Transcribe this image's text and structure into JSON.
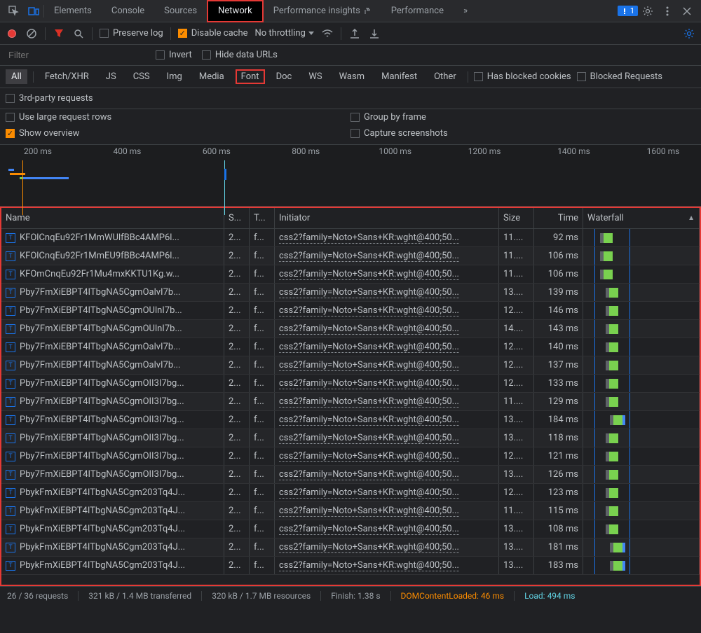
{
  "tabs": {
    "elements": "Elements",
    "console": "Console",
    "sources": "Sources",
    "network": "Network",
    "perf_insights": "Performance insights",
    "performance": "Performance",
    "more": "»",
    "issues_count": "1"
  },
  "toolbar": {
    "preserve_log": "Preserve log",
    "disable_cache": "Disable cache",
    "no_throttling": "No throttling"
  },
  "filter": {
    "placeholder": "Filter",
    "invert": "Invert",
    "hide_data": "Hide data URLs"
  },
  "types": {
    "all": "All",
    "fetch": "Fetch/XHR",
    "js": "JS",
    "css": "CSS",
    "img": "Img",
    "media": "Media",
    "font": "Font",
    "doc": "Doc",
    "ws": "WS",
    "wasm": "Wasm",
    "manifest": "Manifest",
    "other": "Other",
    "blocked_cookies": "Has blocked cookies",
    "blocked_req": "Blocked Requests"
  },
  "opts": {
    "third_party": "3rd-party requests",
    "large_rows": "Use large request rows",
    "group_frame": "Group by frame",
    "show_overview": "Show overview",
    "capture_ss": "Capture screenshots"
  },
  "timeline": {
    "ticks": [
      "200 ms",
      "400 ms",
      "600 ms",
      "800 ms",
      "1000 ms",
      "1200 ms",
      "1400 ms",
      "1600 ms"
    ]
  },
  "table": {
    "headers": {
      "name": "Name",
      "status": "S...",
      "type": "T...",
      "initiator": "Initiator",
      "size": "Size",
      "time": "Time",
      "waterfall": "Waterfall"
    },
    "rows": [
      {
        "name": "KFOlCnqEu92Fr1MmWUlfBBc4AMP6l...",
        "status": "2...",
        "type": "f...",
        "initiator": "css2?family=Noto+Sans+KR:wght@400;50...",
        "size": "11....",
        "time": "92 ms",
        "wf": 18
      },
      {
        "name": "KFOlCnqEu92Fr1MmEU9fBBc4AMP6l...",
        "status": "2...",
        "type": "f...",
        "initiator": "css2?family=Noto+Sans+KR:wght@400;50...",
        "size": "11....",
        "time": "106 ms",
        "wf": 18
      },
      {
        "name": "KFOmCnqEu92Fr1Mu4mxKKTU1Kg.w...",
        "status": "2...",
        "type": "f...",
        "initiator": "css2?family=Noto+Sans+KR:wght@400;50...",
        "size": "11....",
        "time": "106 ms",
        "wf": 18
      },
      {
        "name": "Pby7FmXiEBPT4ITbgNA5CgmOalvI7b...",
        "status": "2...",
        "type": "f...",
        "initiator": "css2?family=Noto+Sans+KR:wght@400;50...",
        "size": "13....",
        "time": "139 ms",
        "wf": 26
      },
      {
        "name": "Pby7FmXiEBPT4ITbgNA5CgmOUlnI7b...",
        "status": "2...",
        "type": "f...",
        "initiator": "css2?family=Noto+Sans+KR:wght@400;50...",
        "size": "12....",
        "time": "146 ms",
        "wf": 26
      },
      {
        "name": "Pby7FmXiEBPT4ITbgNA5CgmOUlnI7b...",
        "status": "2...",
        "type": "f...",
        "initiator": "css2?family=Noto+Sans+KR:wght@400;50...",
        "size": "14....",
        "time": "143 ms",
        "wf": 26
      },
      {
        "name": "Pby7FmXiEBPT4ITbgNA5CgmOalvI7b...",
        "status": "2...",
        "type": "f...",
        "initiator": "css2?family=Noto+Sans+KR:wght@400;50...",
        "size": "12....",
        "time": "140 ms",
        "wf": 26
      },
      {
        "name": "Pby7FmXiEBPT4ITbgNA5CgmOalvI7b...",
        "status": "2...",
        "type": "f...",
        "initiator": "css2?family=Noto+Sans+KR:wght@400;50...",
        "size": "12....",
        "time": "137 ms",
        "wf": 26
      },
      {
        "name": "Pby7FmXiEBPT4ITbgNA5CgmOII3I7bg...",
        "status": "2...",
        "type": "f...",
        "initiator": "css2?family=Noto+Sans+KR:wght@400;50...",
        "size": "12....",
        "time": "133 ms",
        "wf": 26
      },
      {
        "name": "Pby7FmXiEBPT4ITbgNA5CgmOII3I7bg...",
        "status": "2...",
        "type": "f...",
        "initiator": "css2?family=Noto+Sans+KR:wght@400;50...",
        "size": "11....",
        "time": "129 ms",
        "wf": 26
      },
      {
        "name": "Pby7FmXiEBPT4ITbgNA5CgmOII3I7bg...",
        "status": "2...",
        "type": "f...",
        "initiator": "css2?family=Noto+Sans+KR:wght@400;50...",
        "size": "13....",
        "time": "184 ms",
        "wf": 32
      },
      {
        "name": "Pby7FmXiEBPT4ITbgNA5CgmOII3I7bg...",
        "status": "2...",
        "type": "f...",
        "initiator": "css2?family=Noto+Sans+KR:wght@400;50...",
        "size": "13....",
        "time": "118 ms",
        "wf": 26
      },
      {
        "name": "Pby7FmXiEBPT4ITbgNA5CgmOII3I7bg...",
        "status": "2...",
        "type": "f...",
        "initiator": "css2?family=Noto+Sans+KR:wght@400;50...",
        "size": "12....",
        "time": "121 ms",
        "wf": 26
      },
      {
        "name": "Pby7FmXiEBPT4ITbgNA5CgmOII3I7bg...",
        "status": "2...",
        "type": "f...",
        "initiator": "css2?family=Noto+Sans+KR:wght@400;50...",
        "size": "13....",
        "time": "126 ms",
        "wf": 26
      },
      {
        "name": "PbykFmXiEBPT4ITbgNA5Cgm203Tq4J...",
        "status": "2...",
        "type": "f...",
        "initiator": "css2?family=Noto+Sans+KR:wght@400;50...",
        "size": "12....",
        "time": "123 ms",
        "wf": 26
      },
      {
        "name": "PbykFmXiEBPT4ITbgNA5Cgm203Tq4J...",
        "status": "2...",
        "type": "f...",
        "initiator": "css2?family=Noto+Sans+KR:wght@400;50...",
        "size": "11....",
        "time": "115 ms",
        "wf": 26
      },
      {
        "name": "PbykFmXiEBPT4ITbgNA5Cgm203Tq4J...",
        "status": "2...",
        "type": "f...",
        "initiator": "css2?family=Noto+Sans+KR:wght@400;50...",
        "size": "13....",
        "time": "108 ms",
        "wf": 26
      },
      {
        "name": "PbykFmXiEBPT4ITbgNA5Cgm203Tq4J...",
        "status": "2...",
        "type": "f...",
        "initiator": "css2?family=Noto+Sans+KR:wght@400;50...",
        "size": "13....",
        "time": "181 ms",
        "wf": 32
      },
      {
        "name": "PbykFmXiEBPT4ITbgNA5Cgm203Tq4J...",
        "status": "2...",
        "type": "f...",
        "initiator": "css2?family=Noto+Sans+KR:wght@400;50...",
        "size": "13....",
        "time": "183 ms",
        "wf": 32
      }
    ]
  },
  "status": {
    "requests": "26 / 36 requests",
    "transferred": "321 kB / 1.4 MB transferred",
    "resources": "320 kB / 1.7 MB resources",
    "finish": "Finish: 1.38 s",
    "dcl": "DOMContentLoaded: 46 ms",
    "load": "Load: 494 ms"
  }
}
